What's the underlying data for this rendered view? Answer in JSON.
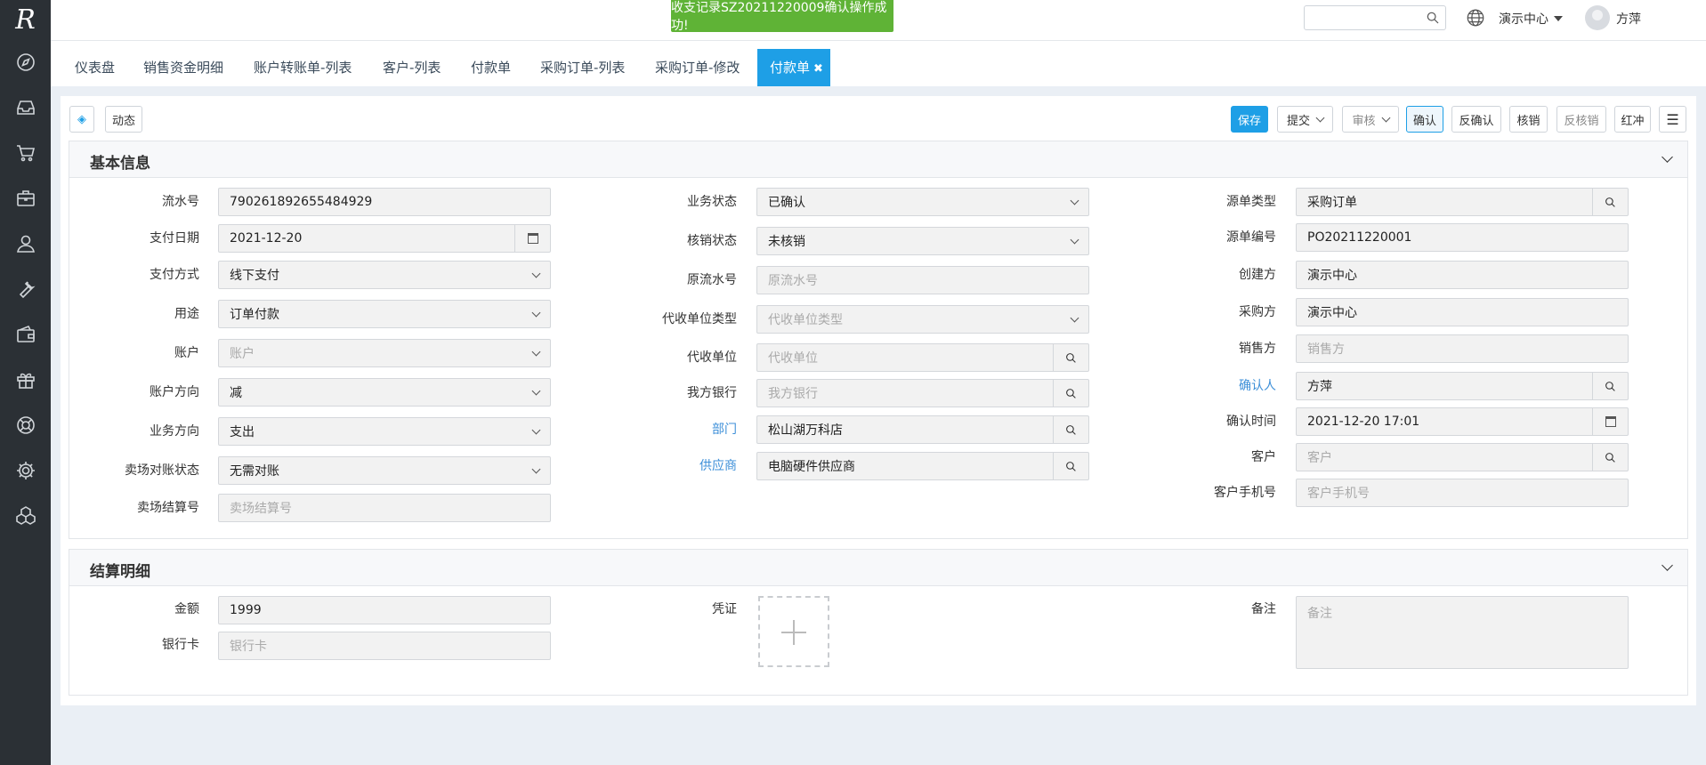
{
  "app": {
    "logo": "R"
  },
  "sidebar": {
    "items": [
      {
        "icon": "compass-icon"
      },
      {
        "icon": "inbox-icon"
      },
      {
        "icon": "cart-icon"
      },
      {
        "icon": "briefcase-icon"
      },
      {
        "icon": "user-icon"
      },
      {
        "icon": "wrench-icon"
      },
      {
        "icon": "wallet-icon"
      },
      {
        "icon": "gift-icon"
      },
      {
        "icon": "lifebuoy-icon"
      },
      {
        "icon": "gear-icon"
      },
      {
        "icon": "cubes-icon"
      }
    ]
  },
  "topbar": {
    "toast": "收支记录SZ20211220009确认操作成功!",
    "search_placeholder": "",
    "org": "演示中心",
    "user": "方萍"
  },
  "tabs": [
    "仪表盘",
    "销售资金明细",
    "账户转账单-列表",
    "客户-列表",
    "付款单",
    "采购订单-列表",
    "采购订单-修改",
    "付款单"
  ],
  "toolbar": {
    "activity": "动态",
    "save": "保存",
    "submit": "提交",
    "audit": "审核",
    "confirm": "确认",
    "unconfirm": "反确认",
    "writeoff": "核销",
    "unwriteoff": "反核销",
    "redflush": "红冲"
  },
  "basic": {
    "title": "基本信息",
    "col1": [
      {
        "label": "流水号",
        "value": "790261892655484929",
        "placeholder": ""
      },
      {
        "label": "支付日期",
        "value": "2021-12-20",
        "placeholder": ""
      },
      {
        "label": "支付方式",
        "value": "线下支付",
        "placeholder": ""
      },
      {
        "label": "用途",
        "value": "订单付款",
        "placeholder": ""
      },
      {
        "label": "账户",
        "value": "",
        "placeholder": "账户"
      },
      {
        "label": "账户方向",
        "value": "减",
        "placeholder": ""
      },
      {
        "label": "业务方向",
        "value": "支出",
        "placeholder": ""
      },
      {
        "label": "卖场对账状态",
        "value": "无需对账",
        "placeholder": ""
      },
      {
        "label": "卖场结算号",
        "value": "",
        "placeholder": "卖场结算号"
      }
    ],
    "col2": [
      {
        "label": "业务状态",
        "value": "已确认",
        "placeholder": ""
      },
      {
        "label": "核销状态",
        "value": "未核销",
        "placeholder": ""
      },
      {
        "label": "原流水号",
        "value": "",
        "placeholder": "原流水号"
      },
      {
        "label": "代收单位类型",
        "value": "",
        "placeholder": "代收单位类型"
      },
      {
        "label": "代收单位",
        "value": "",
        "placeholder": "代收单位"
      },
      {
        "label": "我方银行",
        "value": "",
        "placeholder": "我方银行"
      },
      {
        "label": "部门",
        "value": "松山湖万科店",
        "placeholder": ""
      },
      {
        "label": "供应商",
        "value": "电脑硬件供应商",
        "placeholder": ""
      }
    ],
    "col3": [
      {
        "label": "源单类型",
        "value": "采购订单",
        "placeholder": ""
      },
      {
        "label": "源单编号",
        "value": "PO20211220001",
        "placeholder": ""
      },
      {
        "label": "创建方",
        "value": "演示中心",
        "placeholder": ""
      },
      {
        "label": "采购方",
        "value": "演示中心",
        "placeholder": ""
      },
      {
        "label": "销售方",
        "value": "",
        "placeholder": "销售方"
      },
      {
        "label": "确认人",
        "value": "方萍",
        "placeholder": ""
      },
      {
        "label": "确认时间",
        "value": "2021-12-20 17:01",
        "placeholder": ""
      },
      {
        "label": "客户",
        "value": "",
        "placeholder": "客户"
      },
      {
        "label": "客户手机号",
        "value": "",
        "placeholder": "客户手机号"
      }
    ]
  },
  "settlement": {
    "title": "结算明细",
    "amount_label": "金额",
    "amount": "1999",
    "bankcard_label": "银行卡",
    "bankcard_placeholder": "银行卡",
    "voucher_label": "凭证",
    "remark_label": "备注",
    "remark_placeholder": "备注"
  }
}
